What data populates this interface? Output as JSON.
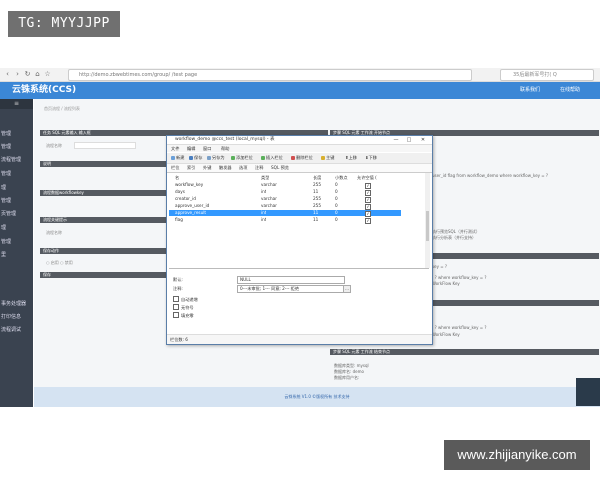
{
  "watermarks": {
    "top": "TG: MYYJJPP",
    "bottom": "www.zhijianyike.com"
  },
  "browser": {
    "url": "http://demo.zbwebtimes.com/group/ /test page",
    "search_placeholder": "35后最新军号打( Q",
    "nav_icons": [
      "back-icon",
      "forward-icon",
      "reload-icon",
      "home-icon",
      "star-icon"
    ]
  },
  "app": {
    "title": "云铢系统(CCS)",
    "header_links": [
      "联系我们",
      "在线帮助"
    ],
    "sidebar_items": [
      "管理",
      "管理",
      "流程管理",
      "管理",
      "理",
      "管理",
      "页管理",
      "理",
      "管理",
      "里",
      "",
      "",
      "",
      "事务处理器",
      "打印信息",
      "流程调试"
    ],
    "breadcrumb": "首页流程 / 流程列表",
    "left_sections": [
      {
        "title": "任务 SQL 元素输入 输入框",
        "fields": [
          "流程名称"
        ]
      },
      {
        "title": "说明",
        "fields": []
      },
      {
        "title": "流程数据workflowkey",
        "fields": []
      },
      {
        "title": "流程关键提示",
        "fields": [
          "流程名称"
        ]
      },
      {
        "title": "保存动作",
        "fields": [
          "○ 启用   ○ 禁用"
        ]
      },
      {
        "title": "保存",
        "fields": []
      }
    ],
    "right_sections": [
      {
        "title": "步骤 SQL 元素 工作流 开始节点",
        "lines": [
          "user_id flag from workflow_demo where workflow_key = ?",
          "执行预览SQL（并行测试）",
          "执行分析表（并行支持）"
        ]
      },
      {
        "title": "",
        "lines": [
          "key = ?",
          "; ? where workflow_key = ?",
          "WorkFlow Key",
          "; ? where workflow_key = ?",
          "WorkFlow Key"
        ]
      },
      {
        "title": "步骤 SQL 元素 工作流 结束节点",
        "lines": [
          "数据库类型: mysql",
          "数据库名: demo",
          "数据库用户名:"
        ]
      }
    ],
    "footer": "云铢系统 V1.0 ©版权所有 技术支持"
  },
  "dialog": {
    "title": "workflow_demo @ccs_test (local_mysql) - 表",
    "menu": [
      "文件",
      "编辑",
      "窗口",
      "帮助"
    ],
    "toolbar": [
      "新建",
      "保存",
      "另存为",
      "添加栏位",
      "插入栏位",
      "删除栏位",
      "主键",
      "上移",
      "下移"
    ],
    "tabs": [
      "栏位",
      "索引",
      "外键",
      "触发器",
      "选项",
      "注释",
      "SQL 预览"
    ],
    "columns": [
      "名",
      "类型",
      "长度",
      "小数点",
      "允许空值 ("
    ],
    "rows": [
      {
        "name": "workflow_key",
        "type": "varchar",
        "length": "255",
        "decimals": "0",
        "nullable": true,
        "selected": false
      },
      {
        "name": "days",
        "type": "int",
        "length": "11",
        "decimals": "0",
        "nullable": true,
        "selected": false
      },
      {
        "name": "creator_id",
        "type": "varchar",
        "length": "255",
        "decimals": "0",
        "nullable": true,
        "selected": false
      },
      {
        "name": "approve_user_id",
        "type": "varchar",
        "length": "255",
        "decimals": "0",
        "nullable": true,
        "selected": false
      },
      {
        "name": "approve_result",
        "type": "int",
        "length": "11",
        "decimals": "0",
        "nullable": true,
        "selected": true
      },
      {
        "name": "flag",
        "type": "int",
        "length": "11",
        "decimals": "0",
        "nullable": true,
        "selected": false
      }
    ],
    "props": {
      "default_label": "默认:",
      "default_value": "NULL",
      "comment_label": "注释:",
      "comment_value": "0---未审批; 1--- 同意; 2--- 拒绝",
      "checks": [
        "自动递增",
        "无符号",
        "填充零"
      ]
    },
    "status": "栏位数: 6"
  },
  "colors": {
    "header": "#3b87d6",
    "sidebar": "#3a4350",
    "selected_row": "#3399ff"
  }
}
